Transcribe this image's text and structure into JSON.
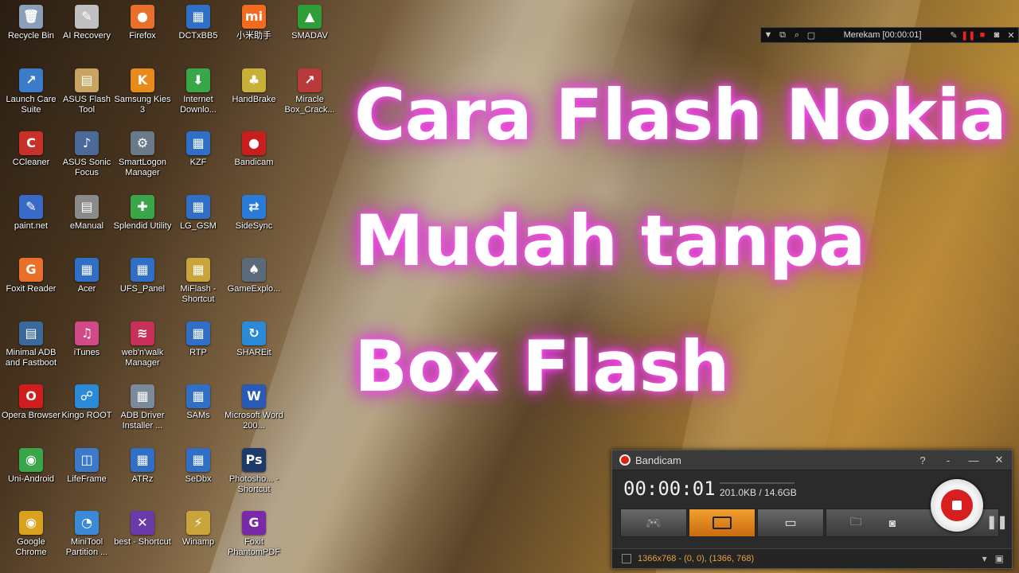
{
  "desktop": {
    "icons": [
      {
        "label": "Recycle Bin",
        "icon": "recycle-bin-icon",
        "color": "#8aa0b8",
        "glyph": "🗑"
      },
      {
        "label": "AI Recovery",
        "icon": "ai-recovery-icon",
        "color": "#c0c0c0",
        "glyph": "✎"
      },
      {
        "label": "Firefox",
        "icon": "firefox-icon",
        "color": "#e8702a",
        "glyph": "●"
      },
      {
        "label": "DCTxBB5",
        "icon": "dctxbb5-icon",
        "color": "#2f6fc8",
        "glyph": "▦"
      },
      {
        "label": "小米助手",
        "icon": "mi-assistant-icon",
        "color": "#f36a21",
        "glyph": "mi"
      },
      {
        "label": "SMADAV",
        "icon": "smadav-icon",
        "color": "#2e9e3a",
        "glyph": "▲"
      },
      {
        "label": "Launch Care Suite",
        "icon": "launch-care-icon",
        "color": "#3a7cc7",
        "glyph": "↗"
      },
      {
        "label": "ASUS Flash Tool",
        "icon": "asus-flash-icon",
        "color": "#c8a460",
        "glyph": "▤"
      },
      {
        "label": "Samsung Kies 3",
        "icon": "samsung-kies-icon",
        "color": "#e98a1c",
        "glyph": "K"
      },
      {
        "label": "Internet Downlo...",
        "icon": "internet-download-icon",
        "color": "#3aa64a",
        "glyph": "⬇"
      },
      {
        "label": "HandBrake",
        "icon": "handbrake-icon",
        "color": "#c8b03a",
        "glyph": "♣"
      },
      {
        "label": "Miracle Box_Crack...",
        "icon": "miracle-box-icon",
        "color": "#b83a3a",
        "glyph": "↗"
      },
      {
        "label": "CCleaner",
        "icon": "ccleaner-icon",
        "color": "#c8302a",
        "glyph": "C"
      },
      {
        "label": "ASUS Sonic Focus",
        "icon": "asus-sonic-icon",
        "color": "#4a6a9a",
        "glyph": "♪"
      },
      {
        "label": "SmartLogon Manager",
        "icon": "smartlogon-icon",
        "color": "#6a7a8a",
        "glyph": "⚙"
      },
      {
        "label": "KZF",
        "icon": "kzf-icon",
        "color": "#2f6fc8",
        "glyph": "▦"
      },
      {
        "label": "Bandicam",
        "icon": "bandicam-icon",
        "color": "#c81e1e",
        "glyph": "●"
      },
      {
        "label": "paint.net",
        "icon": "paint-net-icon",
        "color": "#3a6ac8",
        "glyph": "✎"
      },
      {
        "label": "eManual",
        "icon": "emanual-icon",
        "color": "#8a8a8a",
        "glyph": "▤"
      },
      {
        "label": "Splendid Utility",
        "icon": "splendid-utility-icon",
        "color": "#3aa64a",
        "glyph": "✚"
      },
      {
        "label": "LG_GSM",
        "icon": "lg-gsm-icon",
        "color": "#2f6fc8",
        "glyph": "▦"
      },
      {
        "label": "SideSync",
        "icon": "sidesync-icon",
        "color": "#2a7ad8",
        "glyph": "⇄"
      },
      {
        "label": "Foxit Reader",
        "icon": "foxit-reader-icon",
        "color": "#e8702a",
        "glyph": "G"
      },
      {
        "label": "Acer",
        "icon": "acer-icon",
        "color": "#2f6fc8",
        "glyph": "▦"
      },
      {
        "label": "UFS_Panel",
        "icon": "ufs-panel-icon",
        "color": "#2f6fc8",
        "glyph": "▦"
      },
      {
        "label": "MiFlash - Shortcut",
        "icon": "miflash-icon",
        "color": "#c8a43a",
        "glyph": "▦"
      },
      {
        "label": "GameExplo...",
        "icon": "game-explorer-icon",
        "color": "#5a6a7a",
        "glyph": "♠"
      },
      {
        "label": "Minimal ADB and Fastboot",
        "icon": "minimal-adb-icon",
        "color": "#3a6a9a",
        "glyph": "▤"
      },
      {
        "label": "iTunes",
        "icon": "itunes-icon",
        "color": "#d04a8a",
        "glyph": "♫"
      },
      {
        "label": "web'n'walk Manager",
        "icon": "webnwalk-icon",
        "color": "#c8305a",
        "glyph": "≋"
      },
      {
        "label": "RTP",
        "icon": "rtp-icon",
        "color": "#2f6fc8",
        "glyph": "▦"
      },
      {
        "label": "SHAREit",
        "icon": "shareit-icon",
        "color": "#2a8ad8",
        "glyph": "↻"
      },
      {
        "label": "Opera Browser",
        "icon": "opera-icon",
        "color": "#d01e1e",
        "glyph": "O"
      },
      {
        "label": "Kingo ROOT",
        "icon": "kingo-root-icon",
        "color": "#2a8ad8",
        "glyph": "☍"
      },
      {
        "label": "ADB Driver Installer ...",
        "icon": "adb-driver-icon",
        "color": "#7a8a9a",
        "glyph": "▦"
      },
      {
        "label": "SAMs",
        "icon": "sams-icon",
        "color": "#2f6fc8",
        "glyph": "▦"
      },
      {
        "label": "Microsoft Word 200...",
        "icon": "word-icon",
        "color": "#2a5ab8",
        "glyph": "W"
      },
      {
        "label": "Uni-Android",
        "icon": "uni-android-icon",
        "color": "#3aa64a",
        "glyph": "◉"
      },
      {
        "label": "LifeFrame",
        "icon": "lifeframe-icon",
        "color": "#3a7ac8",
        "glyph": "◫"
      },
      {
        "label": "ATRz",
        "icon": "atrz-icon",
        "color": "#2f6fc8",
        "glyph": "▦"
      },
      {
        "label": "SeDbx",
        "icon": "sedbx-icon",
        "color": "#2f6fc8",
        "glyph": "▦"
      },
      {
        "label": "Photosho... - Shortcut",
        "icon": "photoshop-icon",
        "color": "#1e3a6a",
        "glyph": "Ps"
      },
      {
        "label": "Google Chrome",
        "icon": "chrome-icon",
        "color": "#d8a21e",
        "glyph": "◉"
      },
      {
        "label": "MiniTool Partition ...",
        "icon": "minitool-icon",
        "color": "#3a8ad8",
        "glyph": "◔"
      },
      {
        "label": "best - Shortcut",
        "icon": "best-shortcut-icon",
        "color": "#6a3aa8",
        "glyph": "✕"
      },
      {
        "label": "Winamp",
        "icon": "winamp-icon",
        "color": "#c8a43a",
        "glyph": "⚡"
      },
      {
        "label": "Foxit PhantomPDF",
        "icon": "foxit-phantompdf-icon",
        "color": "#7a2aa8",
        "glyph": "G"
      }
    ]
  },
  "overlay": {
    "line1": "Cara Flash Nokia",
    "line2": "Mudah tanpa",
    "line3": "Box Flash"
  },
  "recbar": {
    "status": "Merekam [00:00:01]"
  },
  "bandicam": {
    "title": "Bandicam",
    "help": "?",
    "timer": "00:00:01",
    "size": "201.0KB / 14.6GB",
    "target": "1366x768 - (0, 0), (1366, 768)",
    "accent": "#e9a23b",
    "record_color": "#d81e1e"
  }
}
